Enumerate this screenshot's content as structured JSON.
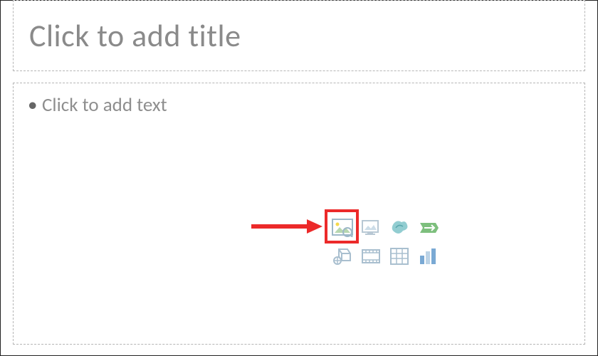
{
  "title": {
    "placeholder": "Click to add title"
  },
  "content": {
    "bullet_placeholder": "Click to add text",
    "icons": {
      "pictures": "Pictures",
      "online_pictures": "Online Pictures",
      "icons": "Icons",
      "smartart": "SmartArt",
      "3d_models": "3D Models",
      "video": "Video",
      "table": "Table",
      "chart": "Chart"
    }
  },
  "annotation": {
    "highlighted_icon": "pictures"
  }
}
